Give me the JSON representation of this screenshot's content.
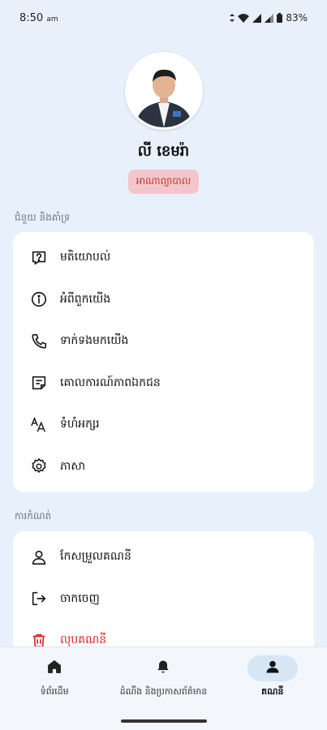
{
  "status": {
    "time": "8:50",
    "ampm": "am",
    "battery": "83%"
  },
  "profile": {
    "name": "លី ខេមរ៉ា",
    "role": "អាណាព្យាបាល"
  },
  "sections": {
    "help_title": "ជំនួយ និងគាំទ្រ",
    "help_items": [
      {
        "label": "មតិយោបល់",
        "icon": "help-icon"
      },
      {
        "label": "អំពីពួកយើង",
        "icon": "info-icon"
      },
      {
        "label": "ទាក់ទងមកយើង",
        "icon": "phone-icon"
      },
      {
        "label": "គោលការណ៍ភាពឯកជន",
        "icon": "policy-icon"
      },
      {
        "label": "ទំហំអក្សរ",
        "icon": "font-size-icon"
      },
      {
        "label": "ភាសា",
        "icon": "language-icon"
      }
    ],
    "settings_title": "ការកំណត់",
    "settings_items": [
      {
        "label": "កែសម្រួលគណនី",
        "icon": "person-icon"
      },
      {
        "label": "ចាកចេញ",
        "icon": "logout-icon"
      },
      {
        "label": "លុបគណនី",
        "icon": "delete-icon"
      }
    ]
  },
  "nav": [
    {
      "label": "ទំព័រដើម",
      "icon": "home-icon"
    },
    {
      "label": "ដំណឹង និងប្រកាសព័ត៌មាន",
      "icon": "bell-icon"
    },
    {
      "label": "គណនី",
      "icon": "account-icon"
    }
  ],
  "colors": {
    "background": "#e8f1fb",
    "danger": "#d62828",
    "badge_bg": "#f3c6cb",
    "active_pill": "#d7e6f5"
  }
}
